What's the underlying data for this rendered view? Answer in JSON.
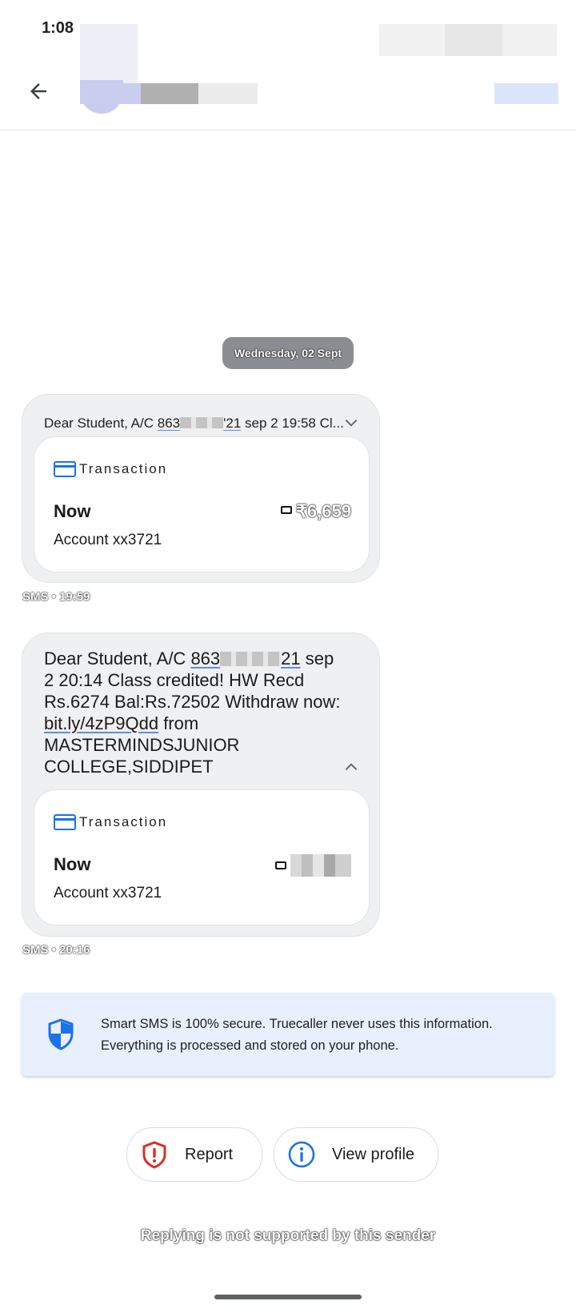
{
  "status_bar": {
    "time": "1:08"
  },
  "app_bar": {
    "back_icon": "arrow-left-icon"
  },
  "conversation": {
    "date_chip": "Wednesday, 02 Sept",
    "messages": [
      {
        "preview_prefix": "Dear Student, A/C ",
        "acct_start": "863",
        "acct_end": "'21",
        "preview_suffix": " sep 2 19:58 Cl...",
        "card": {
          "label": "Transaction",
          "when": "Now",
          "account": "Account xx3721",
          "amount": "₹6,659"
        },
        "meta": "SMS • 19:59"
      },
      {
        "text_prefix": "Dear Student, A/C ",
        "acct_start": "863",
        "acct_end": "21",
        "text_middle": " sep 2 20:14 Class credited! HW Recd Rs.6274 Bal:Rs.72502 Withdraw now: ",
        "link": "bit.ly/4zP9Qdd",
        "text_suffix": " from MASTERMINDSJUNIOR COLLEGE,SIDDIPET",
        "card": {
          "label": "Transaction",
          "when": "Now",
          "account": "Account xx3721"
        },
        "meta": "SMS • 20:16"
      }
    ]
  },
  "secure_notice": {
    "text": "Smart SMS is 100% secure. Truecaller never uses this information. Everything is processed and stored on your phone."
  },
  "actions": {
    "report_label": "Report",
    "view_profile_label": "View profile"
  },
  "footer": "Replying is not supported by this sender",
  "colors": {
    "accent": "#1a73e8",
    "danger": "#d93025",
    "notice_bg": "#e8f0fd",
    "bubble_bg": "#eff0f1"
  }
}
